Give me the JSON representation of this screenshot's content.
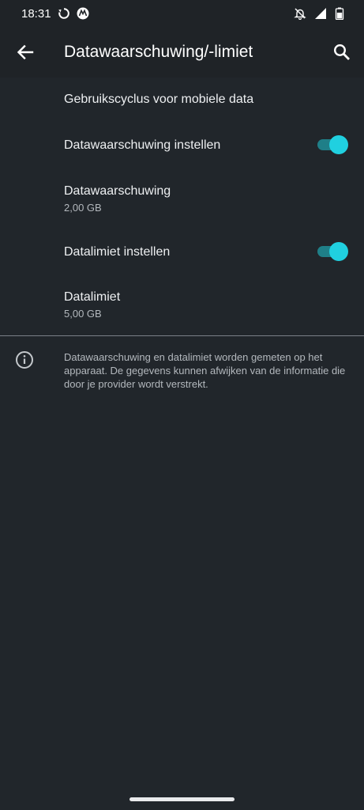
{
  "status_bar": {
    "time": "18:31",
    "icons": [
      "sync-icon",
      "motorola-logo-icon",
      "notifications-off-icon",
      "cellular-signal-icon",
      "battery-icon"
    ]
  },
  "app_bar": {
    "title": "Datawaarschuwing/-limiet",
    "back_icon": "arrow-back-icon",
    "search_icon": "search-icon"
  },
  "settings": {
    "usage_cycle": {
      "title": "Gebruikscyclus voor mobiele data"
    },
    "set_data_warning": {
      "title": "Datawaarschuwing instellen",
      "enabled": true
    },
    "data_warning": {
      "title": "Datawaarschuwing",
      "value": "2,00 GB"
    },
    "set_data_limit": {
      "title": "Datalimiet instellen",
      "enabled": true
    },
    "data_limit": {
      "title": "Datalimiet",
      "value": "5,00 GB"
    }
  },
  "info": {
    "icon": "info-icon",
    "text": "Datawaarschuwing en datalimiet worden gemeten op het apparaat. De gegevens kunnen afwijken van de informatie die door je provider wordt verstrekt."
  },
  "colors": {
    "background": "#21262b",
    "accent": "#20d0e0",
    "accent_track": "#1f7f88"
  }
}
